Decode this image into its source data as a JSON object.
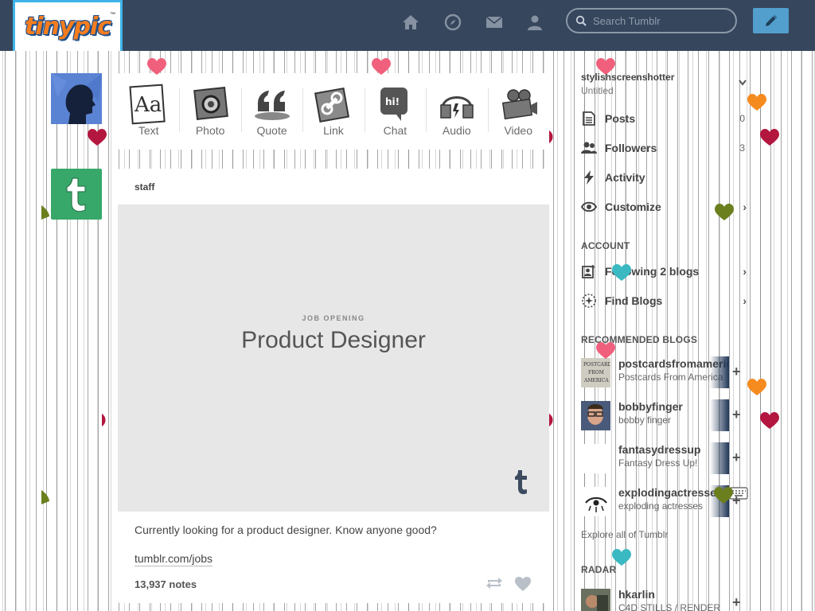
{
  "header": {
    "logo_text": "tinypic",
    "logo_tm": "™",
    "search_placeholder": "Search Tumblr"
  },
  "post_types": [
    {
      "label": "Text"
    },
    {
      "label": "Photo"
    },
    {
      "label": "Quote"
    },
    {
      "label": "Link"
    },
    {
      "label": "Chat"
    },
    {
      "label": "Audio"
    },
    {
      "label": "Video"
    }
  ],
  "post": {
    "author": "staff",
    "kicker": "JOB OPENING",
    "headline": "Product Designer",
    "body": "Currently looking for a product designer. Know anyone good?",
    "link": "tumblr.com/jobs",
    "notes": "13,937 notes"
  },
  "sidebar": {
    "blog_name": "stylishscreenshotter",
    "blog_title": "Untitled",
    "posts_label": "Posts",
    "posts_count": "0",
    "followers_label": "Followers",
    "followers_count": "3",
    "activity_label": "Activity",
    "customize_label": "Customize",
    "account_heading": "ACCOUNT",
    "following_label": "Following 2 blogs",
    "find_blogs_label": "Find Blogs",
    "recommended_heading": "RECOMMENDED BLOGS",
    "recommended": [
      {
        "name": "postcardsfromamerica",
        "desc": "Postcards From America"
      },
      {
        "name": "bobbyfinger",
        "desc": "bobby finger"
      },
      {
        "name": "fantasydressup",
        "desc": "Fantasy Dress Up!"
      },
      {
        "name": "explodingactresses",
        "desc": "exploding actresses"
      }
    ],
    "explore_label": "Explore all of Tumblr",
    "radar_heading": "RADAR",
    "radar": {
      "name": "hkarlin",
      "desc": "C4D STILLS / RENDER"
    }
  },
  "colors": {
    "header_bg": "#36465d",
    "accent_blue": "#529ecc",
    "staff_green": "#37a86a",
    "heart_pink": "#f0607c",
    "heart_red": "#b3163e",
    "heart_orange": "#f58a1f",
    "heart_olive": "#6b7f1f",
    "heart_teal": "#3bb9c2"
  }
}
